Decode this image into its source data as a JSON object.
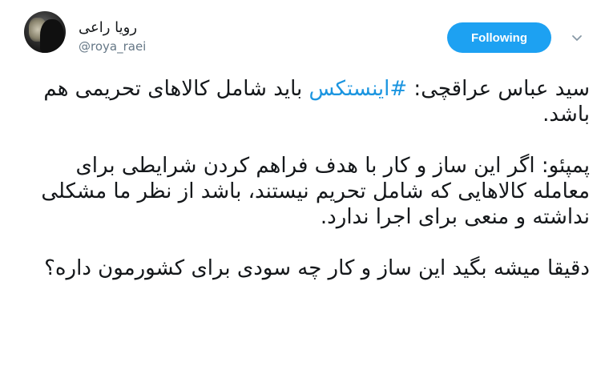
{
  "author": {
    "display_name": "رویا راعی",
    "handle": "@roya_raei"
  },
  "follow_button": {
    "label": "Following"
  },
  "tweet": {
    "line1_prefix": "سید عباس عراقچی: ",
    "hashtag": "#اینستکس",
    "line1_suffix": " باید شامل کالاهای تحریمی هم باشد.",
    "para2": "پمپئو: اگر این ساز و کار با هدف فراهم کردن شرایطی برای معامله کالاهایی که شامل تحریم نیستند، باشد از نظر ما مشکلی نداشته و منعی برای اجرا ندارد.",
    "para3": "دقیقا میشه بگید این ساز و کار چه سودی برای کشورمون داره؟"
  },
  "colors": {
    "accent": "#1da1f2",
    "hashtag": "#1b95e0",
    "text": "#14171a",
    "muted": "#657786"
  },
  "icons": {
    "menu": "chevron-down-icon"
  }
}
